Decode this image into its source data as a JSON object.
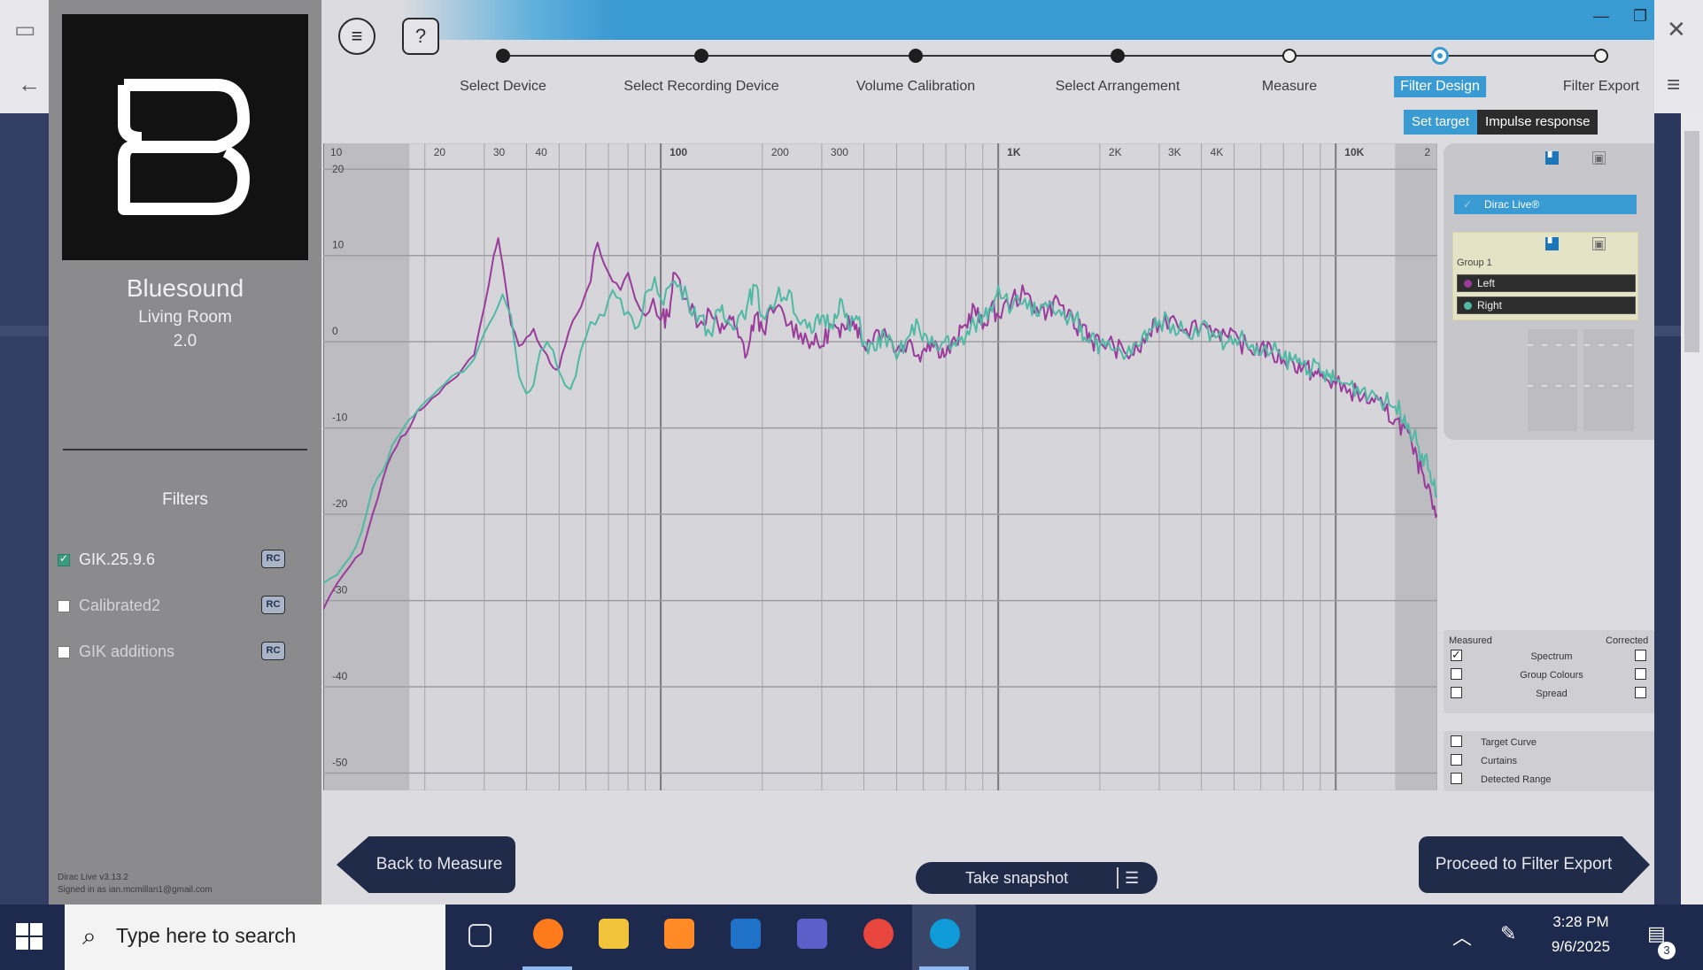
{
  "app": {
    "device_name": "Bluesound",
    "room_name": "Living Room",
    "layout": "2.0",
    "version": "Dirac Live v3.13.2",
    "signed_in": "Signed in as ian.mcmillan1@gmail.com",
    "menu_icon": "hamburger-icon",
    "help_label": "?"
  },
  "filters": {
    "title": "Filters",
    "items": [
      {
        "label": "GIK.25.9.6",
        "checked": true,
        "badge": "RC"
      },
      {
        "label": "Calibrated2",
        "checked": false,
        "badge": "RC"
      },
      {
        "label": "GIK additions",
        "checked": false,
        "badge": "RC"
      }
    ]
  },
  "steps": [
    {
      "label": "Select Device",
      "state": "done"
    },
    {
      "label": "Select Recording Device",
      "state": "done"
    },
    {
      "label": "Volume Calibration",
      "state": "done"
    },
    {
      "label": "Select Arrangement",
      "state": "done"
    },
    {
      "label": "Measure",
      "state": "todo"
    },
    {
      "label": "Filter Design",
      "state": "active"
    },
    {
      "label": "Filter Export",
      "state": "todo"
    }
  ],
  "subtabs": {
    "set_target": "Set target",
    "impulse_response": "Impulse response"
  },
  "chart_data": {
    "type": "line",
    "x_scale": "log",
    "xlim": [
      10,
      20000
    ],
    "ylim": [
      -52,
      23
    ],
    "x_tick_labels": [
      {
        "f": 10,
        "t": "10"
      },
      {
        "f": 20,
        "t": "20"
      },
      {
        "f": 30,
        "t": "30"
      },
      {
        "f": 40,
        "t": "40"
      },
      {
        "f": 100,
        "t": "100"
      },
      {
        "f": 200,
        "t": "200"
      },
      {
        "f": 300,
        "t": "300"
      },
      {
        "f": 1000,
        "t": "1K"
      },
      {
        "f": 2000,
        "t": "2K"
      },
      {
        "f": 3000,
        "t": "3K"
      },
      {
        "f": 4000,
        "t": "4K"
      },
      {
        "f": 10000,
        "t": "10K"
      },
      {
        "f": 20000,
        "t": "2"
      }
    ],
    "y_ticks": [
      20,
      10,
      0,
      -10,
      -20,
      -30,
      -40,
      -50
    ],
    "curtains": {
      "low": [
        10,
        18
      ],
      "high": [
        15000,
        20000
      ]
    },
    "series": [
      {
        "name": "Left",
        "color": "#9a3b9a",
        "points": [
          [
            10,
            -31
          ],
          [
            11,
            -28
          ],
          [
            12,
            -26
          ],
          [
            13,
            -24.5
          ],
          [
            14,
            -20
          ],
          [
            15,
            -16
          ],
          [
            16,
            -13
          ],
          [
            17,
            -11
          ],
          [
            18,
            -10
          ],
          [
            19,
            -8
          ],
          [
            20,
            -7.5
          ],
          [
            22,
            -6
          ],
          [
            24,
            -4.5
          ],
          [
            26,
            -3
          ],
          [
            28,
            -1.5
          ],
          [
            30,
            4
          ],
          [
            32,
            10
          ],
          [
            33,
            12
          ],
          [
            34,
            9
          ],
          [
            36,
            2
          ],
          [
            38,
            -0.5
          ],
          [
            40,
            0.5
          ],
          [
            42,
            1.5
          ],
          [
            44,
            -0.5
          ],
          [
            46,
            -1.5
          ],
          [
            48,
            -3
          ],
          [
            50,
            -3
          ],
          [
            52,
            -0.5
          ],
          [
            55,
            2.5
          ],
          [
            58,
            4
          ],
          [
            62,
            7
          ],
          [
            65,
            11.5
          ],
          [
            68,
            9
          ],
          [
            72,
            7
          ],
          [
            76,
            6
          ],
          [
            80,
            8
          ],
          [
            84,
            5
          ],
          [
            90,
            3
          ],
          [
            95,
            5
          ],
          [
            100,
            2.5
          ],
          [
            105,
            3
          ],
          [
            110,
            8
          ],
          [
            120,
            5
          ],
          [
            130,
            2
          ],
          [
            140,
            3.5
          ],
          [
            150,
            1
          ],
          [
            160,
            3
          ],
          [
            170,
            0.5
          ],
          [
            180,
            -1.5
          ],
          [
            190,
            3
          ],
          [
            200,
            1.5
          ],
          [
            220,
            4
          ],
          [
            240,
            2
          ],
          [
            260,
            1
          ],
          [
            280,
            0
          ],
          [
            300,
            -0.5
          ],
          [
            320,
            2
          ],
          [
            340,
            0.5
          ],
          [
            360,
            3
          ],
          [
            380,
            2
          ],
          [
            400,
            -0.5
          ],
          [
            430,
            1
          ],
          [
            460,
            1.5
          ],
          [
            500,
            -1
          ],
          [
            540,
            0
          ],
          [
            580,
            -1.5
          ],
          [
            620,
            0
          ],
          [
            660,
            -0.5
          ],
          [
            700,
            -1.5
          ],
          [
            750,
            0
          ],
          [
            800,
            2
          ],
          [
            850,
            4
          ],
          [
            900,
            1.5
          ],
          [
            950,
            4
          ],
          [
            1000,
            3
          ],
          [
            1100,
            5
          ],
          [
            1200,
            5.5
          ],
          [
            1300,
            4
          ],
          [
            1400,
            3.5
          ],
          [
            1500,
            5
          ],
          [
            1600,
            3
          ],
          [
            1700,
            1.5
          ],
          [
            1800,
            2
          ],
          [
            1900,
            0
          ],
          [
            2000,
            0
          ],
          [
            2200,
            -0.5
          ],
          [
            2400,
            -1.5
          ],
          [
            2600,
            -1
          ],
          [
            2800,
            1
          ],
          [
            3000,
            2
          ],
          [
            3300,
            3
          ],
          [
            3600,
            1.5
          ],
          [
            4000,
            2
          ],
          [
            4400,
            1.5
          ],
          [
            4800,
            0.5
          ],
          [
            5200,
            0
          ],
          [
            5600,
            -1
          ],
          [
            6000,
            -0.5
          ],
          [
            6500,
            -1.5
          ],
          [
            7000,
            -2
          ],
          [
            7500,
            -2.5
          ],
          [
            8000,
            -3
          ],
          [
            8500,
            -3.5
          ],
          [
            9000,
            -4
          ],
          [
            9500,
            -4.5
          ],
          [
            10000,
            -5
          ],
          [
            11000,
            -5.5
          ],
          [
            12000,
            -6.5
          ],
          [
            13000,
            -7
          ],
          [
            14000,
            -8
          ],
          [
            15000,
            -9
          ],
          [
            16000,
            -10
          ],
          [
            17000,
            -13
          ],
          [
            18000,
            -15
          ],
          [
            19000,
            -17
          ],
          [
            20000,
            -20
          ]
        ]
      },
      {
        "name": "Right",
        "color": "#4fb9a4",
        "points": [
          [
            10,
            -28
          ],
          [
            11,
            -27
          ],
          [
            12,
            -25
          ],
          [
            13,
            -22
          ],
          [
            14,
            -17
          ],
          [
            15,
            -15
          ],
          [
            16,
            -12
          ],
          [
            17,
            -10.5
          ],
          [
            18,
            -9
          ],
          [
            19,
            -8
          ],
          [
            20,
            -7
          ],
          [
            22,
            -5.5
          ],
          [
            24,
            -4
          ],
          [
            26,
            -3.5
          ],
          [
            28,
            -2
          ],
          [
            30,
            1
          ],
          [
            32,
            3
          ],
          [
            34,
            5.5
          ],
          [
            36,
            3
          ],
          [
            38,
            -4
          ],
          [
            40,
            -6
          ],
          [
            42,
            -5
          ],
          [
            44,
            -1
          ],
          [
            46,
            0
          ],
          [
            48,
            -1
          ],
          [
            50,
            -3.5
          ],
          [
            52,
            -5
          ],
          [
            54,
            -5.5
          ],
          [
            56,
            -4
          ],
          [
            58,
            -1
          ],
          [
            60,
            0.5
          ],
          [
            64,
            2
          ],
          [
            68,
            3
          ],
          [
            72,
            6
          ],
          [
            76,
            5
          ],
          [
            80,
            3.5
          ],
          [
            84,
            1.5
          ],
          [
            88,
            3
          ],
          [
            92,
            6
          ],
          [
            96,
            7.5
          ],
          [
            100,
            5
          ],
          [
            110,
            7
          ],
          [
            120,
            5
          ],
          [
            130,
            3
          ],
          [
            140,
            1
          ],
          [
            150,
            3.5
          ],
          [
            160,
            2
          ],
          [
            170,
            3
          ],
          [
            180,
            4
          ],
          [
            190,
            6.5
          ],
          [
            200,
            3
          ],
          [
            220,
            5
          ],
          [
            240,
            6
          ],
          [
            260,
            2
          ],
          [
            280,
            1
          ],
          [
            300,
            3
          ],
          [
            320,
            2
          ],
          [
            340,
            5
          ],
          [
            360,
            1.5
          ],
          [
            380,
            3
          ],
          [
            400,
            0
          ],
          [
            430,
            -1
          ],
          [
            460,
            1
          ],
          [
            500,
            -2
          ],
          [
            540,
            0.5
          ],
          [
            580,
            2
          ],
          [
            620,
            0
          ],
          [
            660,
            -1
          ],
          [
            700,
            0.5
          ],
          [
            750,
            -0.5
          ],
          [
            800,
            0.5
          ],
          [
            850,
            2
          ],
          [
            900,
            3
          ],
          [
            950,
            4
          ],
          [
            1000,
            6.5
          ],
          [
            1100,
            4
          ],
          [
            1200,
            5
          ],
          [
            1300,
            3
          ],
          [
            1400,
            4
          ],
          [
            1500,
            3.5
          ],
          [
            1600,
            2
          ],
          [
            1700,
            3
          ],
          [
            1800,
            0.5
          ],
          [
            1900,
            1
          ],
          [
            2000,
            -0.5
          ],
          [
            2200,
            -1
          ],
          [
            2400,
            -1.5
          ],
          [
            2600,
            -0.5
          ],
          [
            2800,
            1.5
          ],
          [
            3000,
            2.5
          ],
          [
            3300,
            2
          ],
          [
            3600,
            1
          ],
          [
            4000,
            2
          ],
          [
            4400,
            0.5
          ],
          [
            4800,
            0
          ],
          [
            5200,
            0.5
          ],
          [
            5600,
            -0.5
          ],
          [
            6000,
            -1.5
          ],
          [
            6500,
            -1
          ],
          [
            7000,
            -2
          ],
          [
            7500,
            -2
          ],
          [
            8000,
            -2.5
          ],
          [
            8500,
            -3
          ],
          [
            9000,
            -3.5
          ],
          [
            9500,
            -4
          ],
          [
            10000,
            -4.5
          ],
          [
            11000,
            -5
          ],
          [
            12000,
            -5.5
          ],
          [
            13000,
            -6
          ],
          [
            14000,
            -7
          ],
          [
            15000,
            -7.5
          ],
          [
            16000,
            -8.5
          ],
          [
            17000,
            -11
          ],
          [
            18000,
            -13
          ],
          [
            19000,
            -15
          ],
          [
            20000,
            -18
          ]
        ]
      }
    ]
  },
  "right_panel": {
    "dirac_label": "Dirac Live®",
    "group_label": "Group 1",
    "channels": [
      {
        "label": "Left",
        "color": "#9a3b9a"
      },
      {
        "label": "Right",
        "color": "#4fb9a4"
      }
    ]
  },
  "display_options": {
    "measured_label": "Measured",
    "corrected_label": "Corrected",
    "rows": [
      {
        "label": "Spectrum",
        "measured": true,
        "corrected": false
      },
      {
        "label": "Group Colours",
        "measured": false,
        "corrected": false
      },
      {
        "label": "Spread",
        "measured": false,
        "corrected": false
      }
    ],
    "extras": [
      {
        "label": "Target Curve",
        "checked": false
      },
      {
        "label": "Curtains",
        "checked": false
      },
      {
        "label": "Detected Range",
        "checked": false
      }
    ]
  },
  "buttons": {
    "back": "Back to Measure",
    "proceed": "Proceed to Filter Export",
    "snapshot": "Take snapshot"
  },
  "taskbar": {
    "search_placeholder": "Type here to search",
    "time": "3:28 PM",
    "date": "9/6/2025",
    "notification_count": "3",
    "apps": [
      {
        "name": "task-view-icon"
      },
      {
        "name": "firefox-icon",
        "color": "#ff7a1a"
      },
      {
        "name": "file-explorer-icon",
        "color": "#f2c43c"
      },
      {
        "name": "sublime-text-icon",
        "color": "#ff8a26"
      },
      {
        "name": "outlook-icon",
        "color": "#1f72c8"
      },
      {
        "name": "teams-icon",
        "color": "#5b5fc7"
      },
      {
        "name": "chrome-icon",
        "color": "#e8453c"
      },
      {
        "name": "dirac-live-icon",
        "color": "#0e9bd8"
      }
    ]
  }
}
